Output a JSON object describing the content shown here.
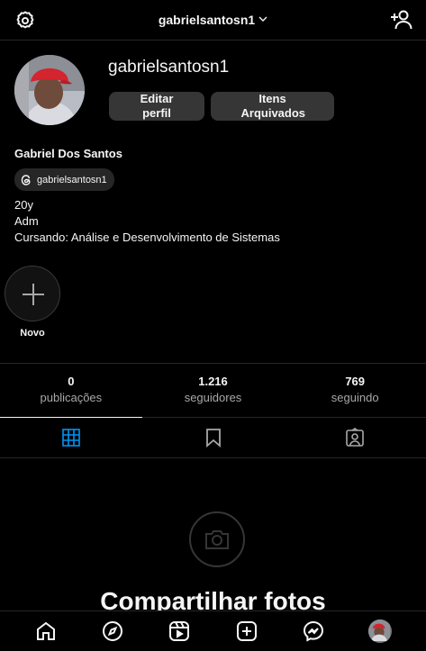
{
  "topbar": {
    "username": "gabrielsantosn1",
    "settings_icon": "settings-icon",
    "add_user_icon": "add-user-icon"
  },
  "profile": {
    "username": "gabrielsantosn1",
    "edit_button": "Editar perfil",
    "archive_button": "Itens Arquivados",
    "full_name": "Gabriel Dos Santos",
    "threads_handle": "gabrielsantosn1",
    "bio_lines": [
      "20y",
      "Adm",
      "Cursando: Análise e Desenvolvimento de Sistemas"
    ]
  },
  "highlights": {
    "new_label": "Novo"
  },
  "stats": [
    {
      "value": "0",
      "label": "publicações"
    },
    {
      "value": "1.216",
      "label": "seguidores"
    },
    {
      "value": "769",
      "label": "seguindo"
    }
  ],
  "tabs": [
    "grid-icon",
    "saved-icon",
    "tagged-icon"
  ],
  "empty_state": {
    "title": "Compartilhar fotos"
  },
  "colors": {
    "background": "#000000",
    "button": "#363636",
    "accent": "#0095f6",
    "divider": "#262626"
  }
}
